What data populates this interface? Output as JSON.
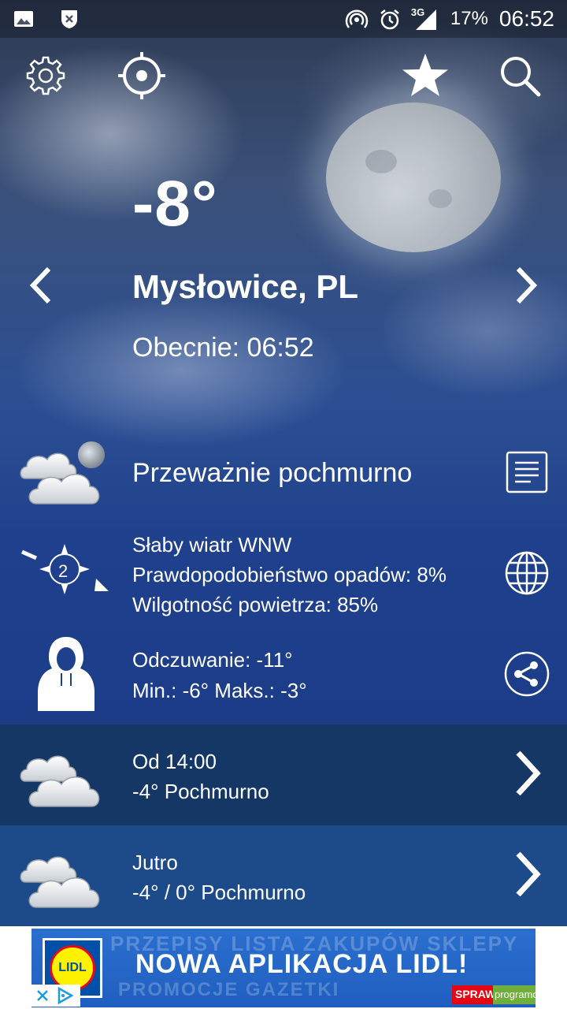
{
  "status_bar": {
    "left_icons": [
      "image-icon",
      "shield-x-icon"
    ],
    "right_icons": [
      "hotspot-icon",
      "alarm-icon",
      "signal-3g-icon"
    ],
    "network": "3G",
    "battery": "17%",
    "time": "06:52"
  },
  "toolbar": {
    "icons": [
      "settings-icon",
      "locate-icon",
      "favorite-star-icon",
      "search-icon"
    ]
  },
  "weather": {
    "temperature": "-8°",
    "city": "Mysłowice, PL",
    "current_time": "Obecnie: 06:52",
    "condition": "Przeważnie pochmurno",
    "wind_badge": "2",
    "wind": "Słaby wiatr WNW",
    "precipitation": "Prawdopodobieństwo opadów: 8%",
    "humidity": "Wilgotność powietrza: 85%",
    "feels_like": "Odczuwanie: -11°",
    "min_max": "Min.: -6° Maks.: -3°"
  },
  "forecast": [
    {
      "title": "Od 14:00",
      "summary": "-4° Pochmurno"
    },
    {
      "title": "Jutro",
      "summary": "-4° / 0° Pochmurno"
    }
  ],
  "ad": {
    "headline": "NOWA APLIKACJA LIDL!",
    "background_words_top": "PRZEPISY   LISTA ZAKUPÓW   SKLEPY",
    "background_words_bottom": "PROMOCJE   GAZETKI",
    "logo_text": "LIDL",
    "red_tag": "SPRAWDŹ",
    "watermark": "programosy.pl"
  },
  "colors": {
    "row_dark": "#153766",
    "row_mid": "#1d4b8a",
    "ad_blue": "#1f5ebf"
  }
}
